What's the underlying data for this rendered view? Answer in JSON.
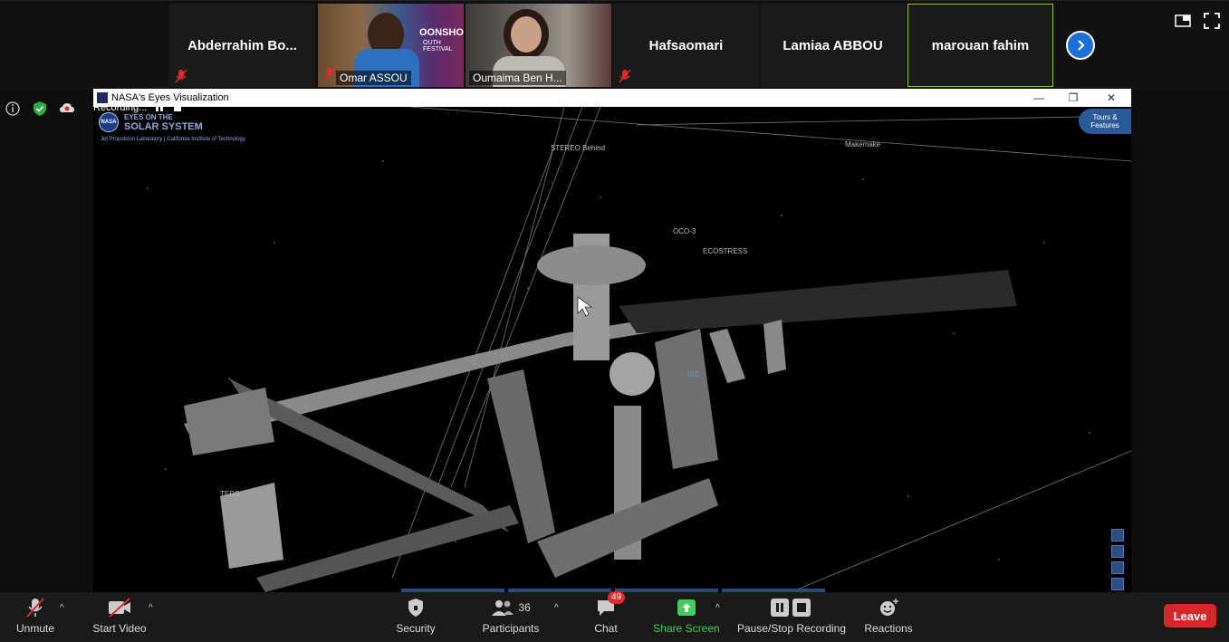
{
  "gallery": {
    "participants": [
      {
        "name": "Abderrahim  Bo...",
        "muted": true,
        "video": false
      },
      {
        "name": "Omar ASSOU",
        "muted": true,
        "video": true
      },
      {
        "name": "Oumaima Ben H...",
        "muted": false,
        "video": true
      },
      {
        "name": "Hafsaomari",
        "muted": true,
        "video": false
      },
      {
        "name": "Lamiaa ABBOU",
        "muted": false,
        "video": false
      },
      {
        "name": "marouan fahim",
        "muted": false,
        "video": false,
        "active_speaker": true
      }
    ],
    "video_overlay_text": "OONSHOT",
    "video_overlay_sub": "OUTH FESTIVAL"
  },
  "recording": {
    "label": "Recording..."
  },
  "shared_window": {
    "title": "NASA's Eyes Visualization",
    "logo_line1": "EYES ON THE",
    "logo_line2": "SOLAR SYSTEM",
    "logo_sub": "Jet Propulsion Laboratory | California Institute of Technology",
    "nasa": "NASA",
    "tours_label": "Tours & Features",
    "labels": {
      "stereo": "STEREO Behind",
      "makemake": "Makemake",
      "oco3": "OCO-3",
      "ecostress": "ECOSTRESS",
      "iss": "ISS",
      "ters": "TERS"
    }
  },
  "toolbar": {
    "unmute": "Unmute",
    "start_video": "Start Video",
    "security": "Security",
    "participants": "Participants",
    "participants_count": "36",
    "chat": "Chat",
    "chat_badge": "49",
    "share_screen": "Share Screen",
    "recording": "Pause/Stop Recording",
    "reactions": "Reactions",
    "leave": "Leave"
  },
  "colors": {
    "accent_green": "#3fce59",
    "leave_red": "#d7272a",
    "active_border": "#8cc43a",
    "arrow_blue": "#1b6fd6"
  }
}
